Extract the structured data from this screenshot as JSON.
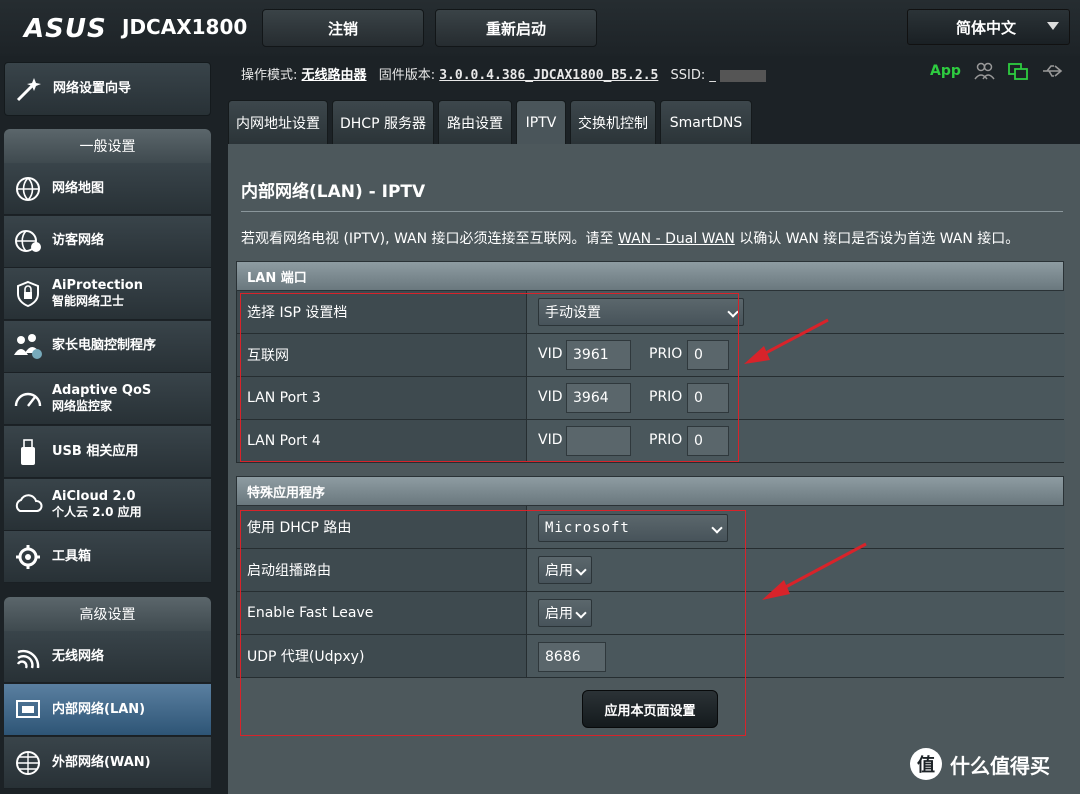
{
  "brand": {
    "logo": "ASUS",
    "model": "JDCAX1800"
  },
  "top_buttons": {
    "logout": "注销",
    "reboot": "重新启动"
  },
  "language": "简体中文",
  "status": {
    "mode_label": "操作模式:",
    "mode_value": "无线路由器",
    "firmware_label": "固件版本:",
    "firmware_value": "3.0.0.4.386_JDCAX1800_B5.2.5",
    "ssid_label": "SSID:",
    "ssid_value": "_",
    "app_label": "App"
  },
  "sidebar": {
    "wizard": "网络设置向导",
    "general_header": "一般设置",
    "general": [
      {
        "label": "网络地图",
        "icon": "network-map-icon"
      },
      {
        "label": "访客网络",
        "icon": "guest-network-icon"
      },
      {
        "label": "AiProtection",
        "sub": "智能网络卫士",
        "icon": "aiprotection-icon"
      },
      {
        "label": "家长电脑控制程序",
        "icon": "parental-control-icon"
      },
      {
        "label": "Adaptive QoS",
        "sub": "网络监控家",
        "icon": "qos-icon"
      },
      {
        "label": "USB 相关应用",
        "icon": "usb-icon"
      },
      {
        "label": "AiCloud 2.0",
        "sub": "个人云 2.0 应用",
        "icon": "cloud-icon"
      },
      {
        "label": "工具箱",
        "icon": "toolbox-icon"
      }
    ],
    "advanced_header": "高级设置",
    "advanced": [
      {
        "label": "无线网络",
        "icon": "wireless-icon"
      },
      {
        "label": "内部网络(LAN)",
        "icon": "lan-icon"
      },
      {
        "label": "外部网络(WAN)",
        "icon": "wan-icon"
      }
    ]
  },
  "tabs": [
    "内网地址设置",
    "DHCP 服务器",
    "路由设置",
    "IPTV",
    "交换机控制",
    "SmartDNS"
  ],
  "page": {
    "title": "内部网络(LAN) - IPTV",
    "desc_before": "若观看网络电视 (IPTV), WAN 接口必须连接至互联网。请至",
    "desc_link": "WAN - Dual WAN",
    "desc_after": "以确认 WAN 接口是否设为首选 WAN 接口。"
  },
  "lan_section": {
    "header": "LAN 端口",
    "isp_label": "选择 ISP 设置档",
    "isp_value": "手动设置",
    "vid_label": "VID",
    "prio_label": "PRIO",
    "ports": [
      {
        "name": "互联网",
        "vid": "3961",
        "prio": "0"
      },
      {
        "name": "LAN Port 3",
        "vid": "3964",
        "prio": "0"
      },
      {
        "name": "LAN Port 4",
        "vid": "",
        "prio": "0"
      }
    ]
  },
  "special_section": {
    "header": "特殊应用程序",
    "dhcp_label": "使用 DHCP 路由",
    "dhcp_value": "Microsoft",
    "multicast_label": "启动组播路由",
    "multicast_value": "启用",
    "fastleave_label": "Enable Fast Leave",
    "fastleave_value": "启用",
    "udp_label": "UDP 代理(Udpxy)",
    "udp_value": "8686"
  },
  "apply_button": "应用本页面设置",
  "watermark": {
    "logo": "值",
    "text": "什么值得买"
  },
  "colors": {
    "accent_red": "#d8232a",
    "app_green": "#2ecc40",
    "active_blue": "#2e5576"
  }
}
